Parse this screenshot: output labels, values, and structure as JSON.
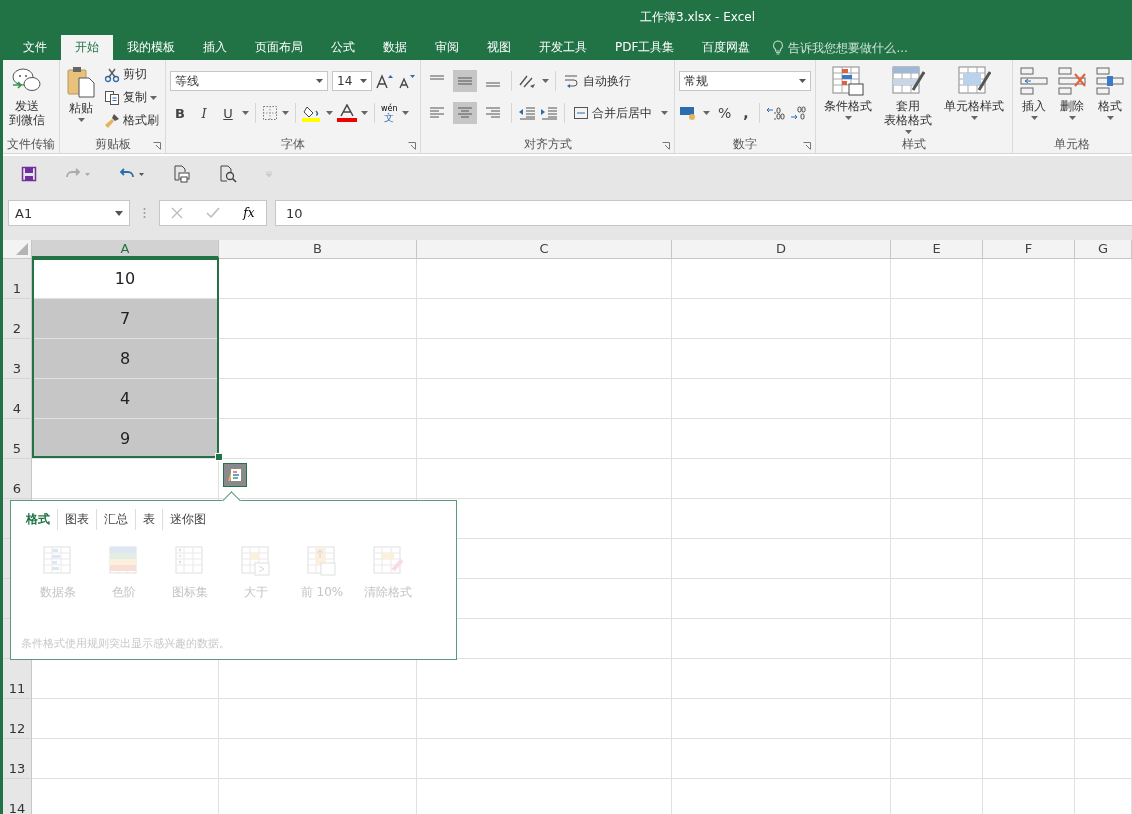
{
  "window": {
    "title": "工作簿3.xlsx - Excel"
  },
  "tabs": [
    {
      "label": "文件",
      "selected": false
    },
    {
      "label": "开始",
      "selected": true
    },
    {
      "label": "我的模板",
      "selected": false
    },
    {
      "label": "插入",
      "selected": false
    },
    {
      "label": "页面布局",
      "selected": false
    },
    {
      "label": "公式",
      "selected": false
    },
    {
      "label": "数据",
      "selected": false
    },
    {
      "label": "审阅",
      "selected": false
    },
    {
      "label": "视图",
      "selected": false
    },
    {
      "label": "开发工具",
      "selected": false
    },
    {
      "label": "PDF工具集",
      "selected": false
    },
    {
      "label": "百度网盘",
      "selected": false
    }
  ],
  "tell_me": {
    "placeholder": "告诉我您想要做什么..."
  },
  "ribbon": {
    "groups": [
      {
        "kind": "wechat",
        "name": "文件传输",
        "button": [
          "发送",
          "到微信"
        ]
      },
      {
        "kind": "clipboard",
        "name": "剪贴板",
        "paste": "粘贴",
        "items": [
          "剪切",
          "复制",
          "格式刷"
        ]
      },
      {
        "kind": "font",
        "name": "字体",
        "font": "等线",
        "size": "14",
        "styles": [
          "B",
          "I",
          "U"
        ],
        "phonetic": [
          "wén",
          "文"
        ]
      },
      {
        "kind": "align",
        "name": "对齐方式",
        "vertical": [
          {
            "selected": false
          },
          {
            "selected": true
          },
          {
            "selected": false
          }
        ],
        "horizontal": [
          {
            "selected": false
          },
          {
            "selected": true
          },
          {
            "selected": false
          }
        ],
        "wrap": "自动换行",
        "merge": "合并后居中"
      },
      {
        "kind": "number",
        "name": "数字",
        "format": "常规",
        "percent": "%",
        "comma": ","
      },
      {
        "kind": "styles",
        "name": "样式",
        "items": [
          [
            "条件格式"
          ],
          [
            "套用",
            "表格格式"
          ],
          [
            "单元格样式"
          ]
        ]
      },
      {
        "kind": "cells",
        "name": "单元格",
        "items": [
          "插入",
          "删除",
          "格式"
        ]
      }
    ]
  },
  "formula_bar": {
    "name_box": "A1",
    "fx": "fx",
    "value": "10"
  },
  "columns": [
    "A",
    "B",
    "C",
    "D",
    "E",
    "F",
    "G"
  ],
  "rows": [
    {
      "header": "1",
      "cells": [
        {
          "value": "10",
          "selected": false
        }
      ]
    },
    {
      "header": "2",
      "cells": [
        {
          "value": "7",
          "selected": true
        }
      ]
    },
    {
      "header": "3",
      "cells": [
        {
          "value": "8",
          "selected": true
        }
      ]
    },
    {
      "header": "4",
      "cells": [
        {
          "value": "4",
          "selected": true
        }
      ]
    },
    {
      "header": "5",
      "cells": [
        {
          "value": "9",
          "selected": true
        }
      ]
    },
    {
      "header": "6",
      "cells": []
    },
    {
      "cells": []
    },
    {
      "cells": []
    },
    {
      "cells": []
    },
    {
      "cells": []
    },
    {
      "header": "11",
      "cells": []
    },
    {
      "header": "12",
      "cells": []
    },
    {
      "header": "13",
      "cells": []
    },
    {
      "header": "14",
      "cells": []
    }
  ],
  "quick_analysis": {
    "tabs": [
      {
        "label": "格式",
        "selected": true
      },
      {
        "label": "图表",
        "selected": false
      },
      {
        "label": "汇总",
        "selected": false
      },
      {
        "label": "表",
        "selected": false
      },
      {
        "label": "迷你图",
        "selected": false
      }
    ],
    "options": [
      {
        "label": "数据条",
        "disabled": true
      },
      {
        "label": "色阶",
        "disabled": true
      },
      {
        "label": "图标集",
        "disabled": true
      },
      {
        "label": "大于",
        "disabled": true
      },
      {
        "label": "前 10%",
        "disabled": true
      },
      {
        "label": "清除格式",
        "disabled": true
      }
    ],
    "description": "条件格式使用规则突出显示感兴趣的数据。"
  }
}
